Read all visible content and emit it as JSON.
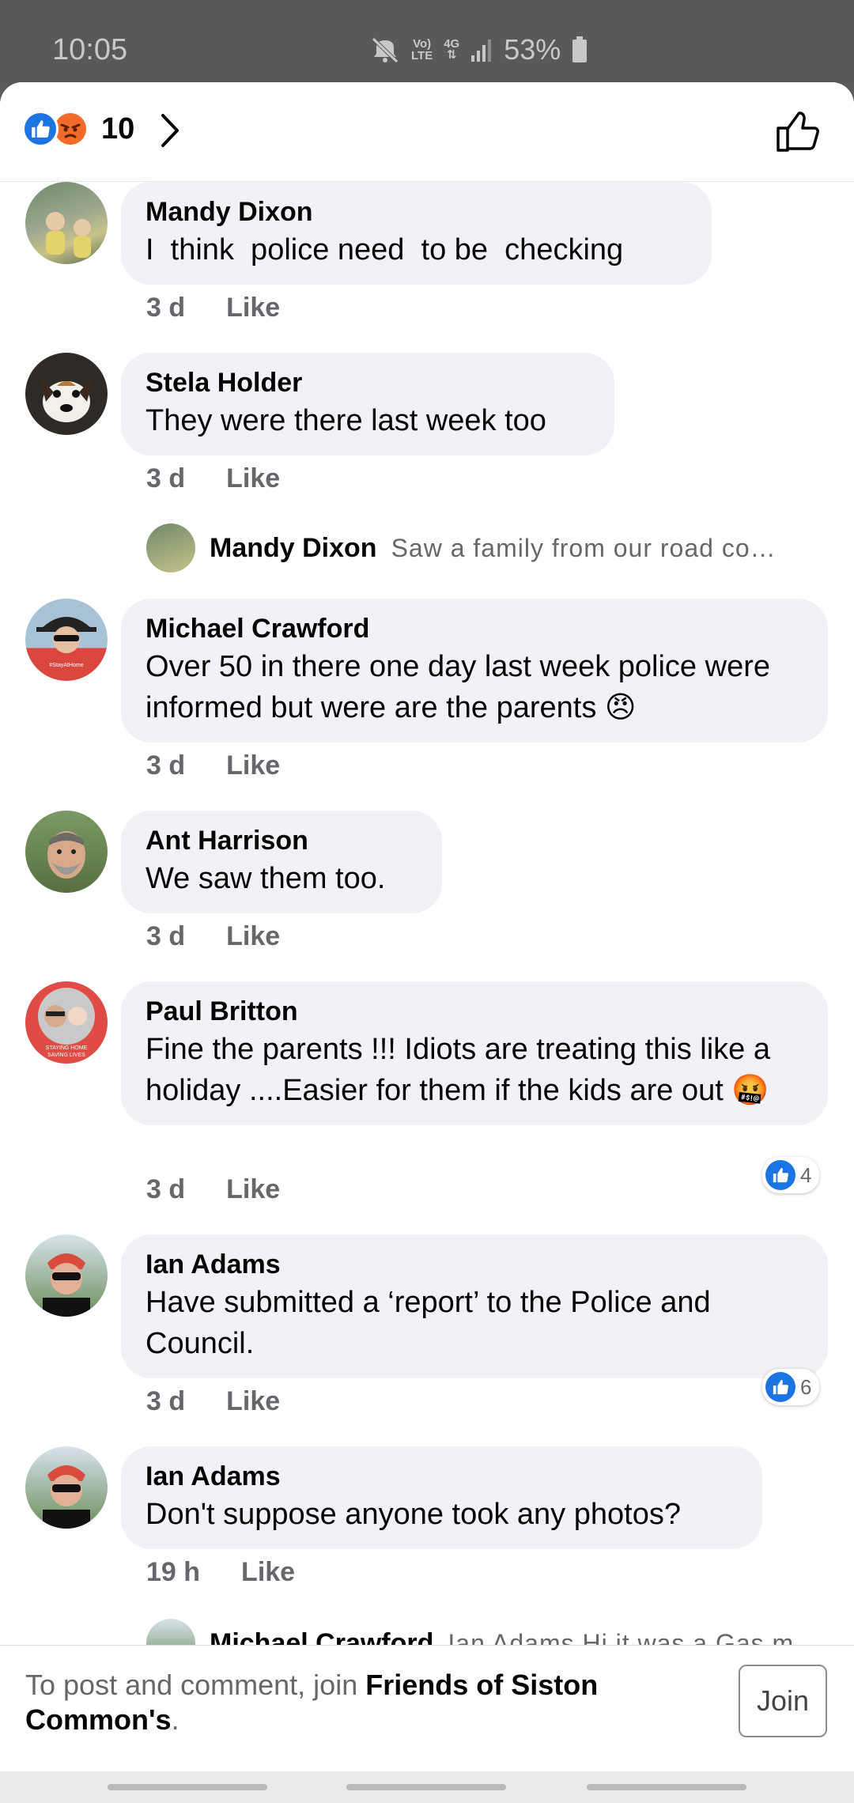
{
  "status_bar": {
    "time": "10:05",
    "volte": "Vo)\nLTE",
    "network": "4G",
    "battery": "53%"
  },
  "header": {
    "reaction_count": "10",
    "reactions": [
      "like",
      "angry"
    ]
  },
  "comments": [
    {
      "author": "Mandy Dixon",
      "text": "I  think  police need  to be  checking",
      "time": "3 d",
      "like_label": "Like"
    },
    {
      "author": "Stela Holder",
      "text": "They were there last week too",
      "time": "3 d",
      "like_label": "Like",
      "reply_preview": {
        "author": "Mandy Dixon",
        "text": "Saw a family from our road co…"
      }
    },
    {
      "author": "Michael Crawford",
      "text": "Over 50 in there one day last week police were informed but were are the parents 😠",
      "time": "3 d",
      "like_label": "Like"
    },
    {
      "author": "Ant Harrison",
      "text": "We saw them too.",
      "time": "3 d",
      "like_label": "Like"
    },
    {
      "author": "Paul Britton",
      "text": "Fine the parents !!! Idiots are treating this like a holiday ....Easier for them if the kids are out 🤬",
      "time": "3 d",
      "like_label": "Like",
      "likes": "4"
    },
    {
      "author": "Ian Adams",
      "text": "Have submitted a ‘report’ to the Police and Council.",
      "time": "3 d",
      "like_label": "Like",
      "likes": "6"
    },
    {
      "author": "Ian Adams",
      "text": "Don't suppose anyone took any photos?",
      "time": "19 h",
      "like_label": "Like",
      "reply_preview": {
        "author": "Michael Crawford",
        "text": "Ian Adams Hi it was a Gas m"
      }
    }
  ],
  "footer": {
    "prefix": "To post and comment, join ",
    "group": "Friends of Siston Common's",
    "suffix": ".",
    "join_label": "Join"
  },
  "colors": {
    "brand_blue": "#1b74e4",
    "bubble_bg": "#f0f2f5",
    "meta_gray": "#65676b"
  }
}
